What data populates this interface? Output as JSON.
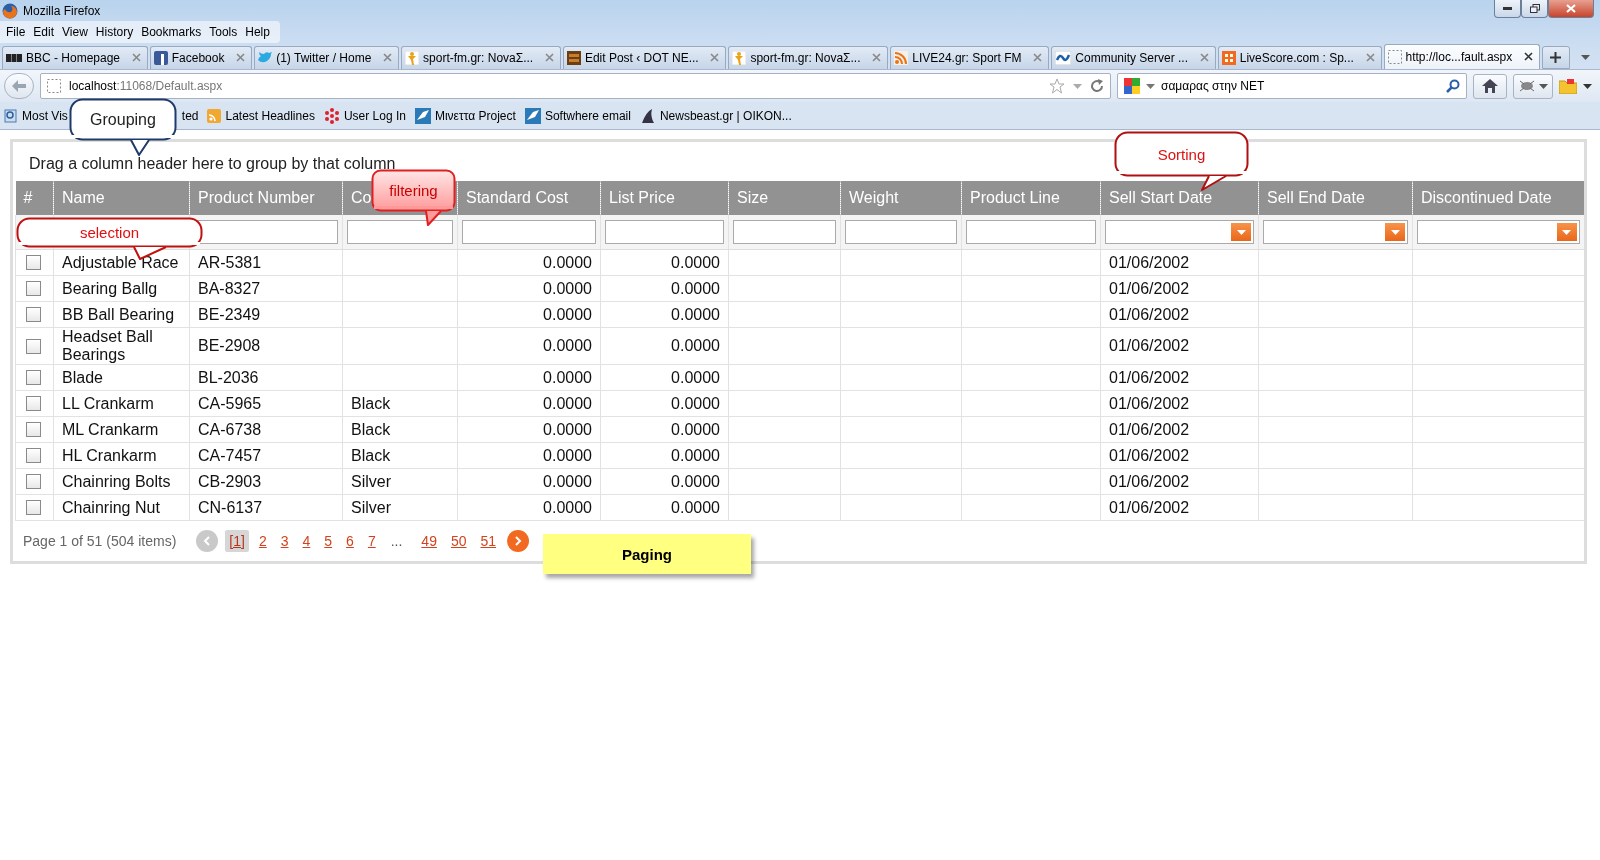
{
  "window": {
    "title": "Mozilla Firefox"
  },
  "menu": [
    "File",
    "Edit",
    "View",
    "History",
    "Bookmarks",
    "Tools",
    "Help"
  ],
  "tabs": [
    {
      "label": "BBC - Homepage",
      "selected": false
    },
    {
      "label": "Facebook",
      "selected": false
    },
    {
      "label": "(1) Twitter / Home",
      "selected": false
    },
    {
      "label": "sport-fm.gr: NovaΣ...",
      "selected": false
    },
    {
      "label": "Edit Post ‹ DOT NE...",
      "selected": false
    },
    {
      "label": "sport-fm.gr: NovaΣ...",
      "selected": false
    },
    {
      "label": "LIVE24.gr: Sport FM",
      "selected": false
    },
    {
      "label": "Community Server ...",
      "selected": false
    },
    {
      "label": "LiveScore.com : Sp...",
      "selected": false
    },
    {
      "label": "http://loc...fault.aspx",
      "selected": true
    }
  ],
  "address": {
    "host": "localhost",
    "path": ":11068/Default.aspx"
  },
  "search": {
    "value": "σαμαρας στην NET"
  },
  "bookmarks": [
    "Most Vis",
    "ted",
    "Latest Headlines",
    "User Log In",
    "Μινεττα Project",
    "Softwhere email",
    "Newsbeast.gr | OIKON..."
  ],
  "grid": {
    "group_hint": "Drag a column header here to group by that column",
    "columns": [
      {
        "label": "#",
        "kind": "check"
      },
      {
        "label": "Name",
        "kind": "text"
      },
      {
        "label": "Product Number",
        "kind": "text"
      },
      {
        "label": "Co",
        "kind": "text"
      },
      {
        "label": "Standard Cost",
        "kind": "number"
      },
      {
        "label": "List Price",
        "kind": "number"
      },
      {
        "label": "Size",
        "kind": "text"
      },
      {
        "label": "Weight",
        "kind": "text"
      },
      {
        "label": "Product Line",
        "kind": "text"
      },
      {
        "label": "Sell Start Date",
        "kind": "date"
      },
      {
        "label": "Sell End Date",
        "kind": "date"
      },
      {
        "label": "Discontinued Date",
        "kind": "date"
      }
    ],
    "rows": [
      {
        "checked": false,
        "name": "Adjustable Race",
        "number": "AR-5381",
        "standard_cost": "0.0000",
        "list_price": "0.0000",
        "sell_start": "01/06/2002"
      },
      {
        "checked": false,
        "name": "Bearing Ballg",
        "number": "BA-8327",
        "standard_cost": "0.0000",
        "list_price": "0.0000",
        "sell_start": "01/06/2002"
      },
      {
        "checked": false,
        "name": "BB Ball Bearing",
        "number": "BE-2349",
        "standard_cost": "0.0000",
        "list_price": "0.0000",
        "sell_start": "01/06/2002"
      },
      {
        "checked": false,
        "name": "Headset Ball Bearings",
        "number": "BE-2908",
        "standard_cost": "0.0000",
        "list_price": "0.0000",
        "sell_start": "01/06/2002"
      },
      {
        "checked": false,
        "name": "Blade",
        "number": "BL-2036",
        "standard_cost": "0.0000",
        "list_price": "0.0000",
        "sell_start": "01/06/2002"
      },
      {
        "checked": false,
        "name": "LL Crankarm",
        "number": "CA-5965",
        "color_name": "Black",
        "standard_cost": "0.0000",
        "list_price": "0.0000",
        "sell_start": "01/06/2002"
      },
      {
        "checked": false,
        "name": "ML Crankarm",
        "number": "CA-6738",
        "color_name": "Black",
        "standard_cost": "0.0000",
        "list_price": "0.0000",
        "sell_start": "01/06/2002"
      },
      {
        "checked": false,
        "name": "HL Crankarm",
        "number": "CA-7457",
        "color_name": "Black",
        "standard_cost": "0.0000",
        "list_price": "0.0000",
        "sell_start": "01/06/2002"
      },
      {
        "checked": false,
        "name": "Chainring Bolts",
        "number": "CB-2903",
        "color_name": "Silver",
        "standard_cost": "0.0000",
        "list_price": "0.0000",
        "sell_start": "01/06/2002"
      },
      {
        "checked": false,
        "name": "Chainring Nut",
        "number": "CN-6137",
        "color_name": "Silver",
        "standard_cost": "0.0000",
        "list_price": "0.0000",
        "sell_start": "01/06/2002"
      }
    ],
    "pager": {
      "info": "Page 1 of 51 (504 items)",
      "prev_disabled": true,
      "next_disabled": false,
      "pages": [
        {
          "label": "[1]",
          "kind": "page",
          "selected": true
        },
        {
          "label": "2",
          "kind": "page",
          "selected": false
        },
        {
          "label": "3",
          "kind": "page",
          "selected": false
        },
        {
          "label": "4",
          "kind": "page",
          "selected": false
        },
        {
          "label": "5",
          "kind": "page",
          "selected": false
        },
        {
          "label": "6",
          "kind": "page",
          "selected": false
        },
        {
          "label": "7",
          "kind": "page",
          "selected": false
        },
        {
          "label": "...",
          "kind": "ellipsis"
        },
        {
          "label": "49",
          "kind": "page",
          "selected": false
        },
        {
          "label": "50",
          "kind": "page",
          "selected": false
        },
        {
          "label": "51",
          "kind": "page",
          "selected": false
        }
      ]
    }
  },
  "callouts": [
    {
      "kind": "grouping",
      "text": "Grouping"
    },
    {
      "kind": "filtering",
      "text": "filtering"
    },
    {
      "kind": "selection",
      "text": "selection"
    },
    {
      "kind": "sorting",
      "text": "Sorting"
    },
    {
      "kind": "paging",
      "text": "Paging"
    }
  ]
}
